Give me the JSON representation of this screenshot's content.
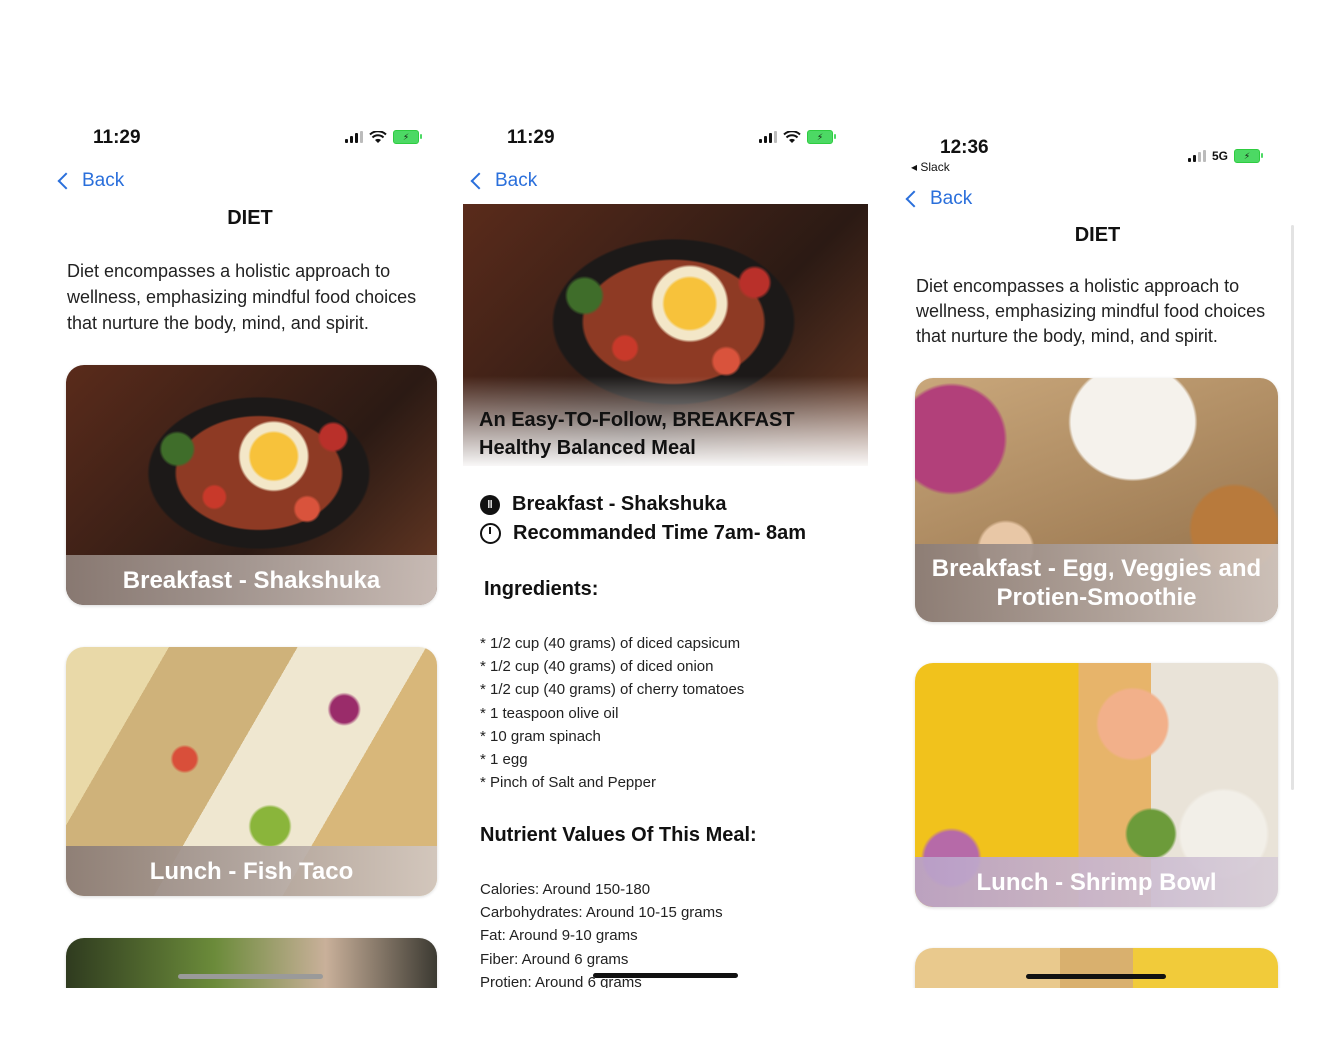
{
  "phone1": {
    "time": "11:29",
    "back_label": "Back",
    "title": "DIET",
    "intro": "Diet encompasses a holistic approach to wellness, emphasizing mindful food choices that nurture the body, mind, and spirit.",
    "cards": [
      {
        "label": "Breakfast - Shakshuka"
      },
      {
        "label": "Lunch - Fish Taco"
      }
    ]
  },
  "phone2": {
    "time": "11:29",
    "back_label": "Back",
    "hero_title": "An Easy-TO-Follow, BREAKFAST Healthy Balanced Meal",
    "meal_name": "Breakfast - Shakshuka",
    "recommended_time": "Recommanded Time 7am- 8am",
    "ingredients_heading": "Ingredients:",
    "ingredients": [
      "* 1/2 cup (40 grams) of diced capsicum",
      "* 1/2 cup (40 grams) of diced onion",
      "* 1/2 cup (40 grams) of cherry tomatoes",
      "* 1 teaspoon olive oil",
      "* 10 gram spinach",
      "* 1 egg",
      "* Pinch of Salt and Pepper"
    ],
    "nutrients_heading": "Nutrient Values Of This Meal:",
    "nutrients": [
      "Calories: Around 150-180",
      "Carbohydrates: Around 10-15 grams",
      "Fat: Around 9-10 grams",
      "Fiber: Around 6 grams",
      "Protien: Around 6 grams"
    ]
  },
  "phone3": {
    "time": "12:36",
    "return_app": "Slack",
    "network": "5G",
    "back_label": "Back",
    "title": "DIET",
    "intro": "Diet encompasses a holistic approach to wellness, emphasizing mindful food choices that nurture the body, mind, and spirit.",
    "cards": [
      {
        "label": "Breakfast - Egg, Veggies and Protien-Smoothie"
      },
      {
        "label": "Lunch - Shrimp Bowl"
      }
    ]
  },
  "colors": {
    "accent": "#2a6fdb",
    "battery": "#4cd964"
  },
  "icons": [
    "chevron-left-icon",
    "signal-icon",
    "wifi-icon",
    "battery-charging-icon",
    "dish-icon",
    "clock-icon"
  ]
}
